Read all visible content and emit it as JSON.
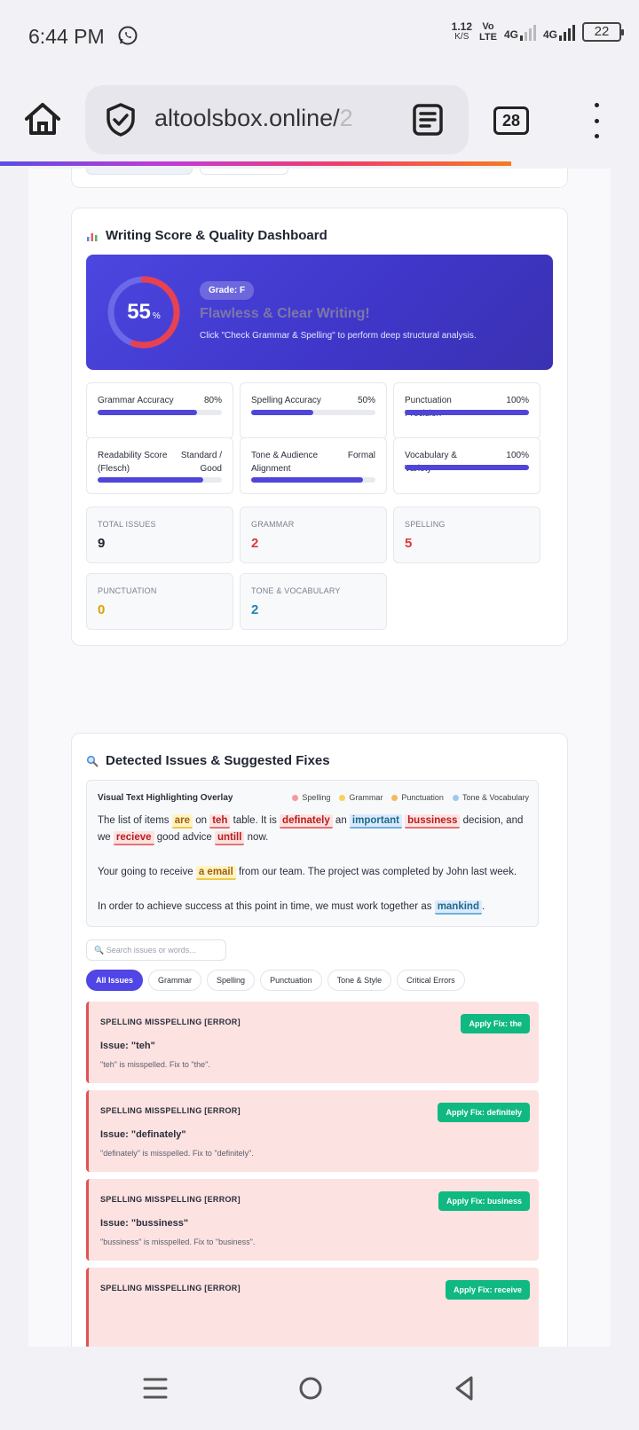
{
  "status": {
    "time": "6:44 PM",
    "net_speed": "1.12",
    "net_unit": "K/S",
    "volte_top": "Vo",
    "volte_bottom": "LTE",
    "sig1": "4G",
    "sig2": "4G",
    "battery": "22"
  },
  "browser": {
    "url": "altoolsbox.online/",
    "url_fade": "2",
    "tab_count": "28"
  },
  "dashboard": {
    "title": "Writing Score & Quality Dashboard",
    "score": 55,
    "score_text": "55",
    "score_unit": "%",
    "grade": "Grade: F",
    "headline": "Flawless & Clear Writing!",
    "subtitle": "Click \"Check Grammar & Spelling\" to perform deep structural analysis.",
    "colors": {
      "ring_progress": "#e8414f",
      "ring_track": "#6d68e8",
      "bar": "#4f46d9"
    },
    "metrics": [
      {
        "label": "Grammar Accuracy",
        "value": "80%",
        "progress": 80
      },
      {
        "label": "Spelling Accuracy",
        "value": "50%",
        "progress": 50
      },
      {
        "label": "Punctuation Precision",
        "value": "100%",
        "progress": 100
      },
      {
        "label": "Readability Score (Flesch)",
        "value": "Standard / Good",
        "progress": 85
      },
      {
        "label": "Tone & Audience Alignment",
        "value": "Formal",
        "progress": 90
      },
      {
        "label": "Vocabulary & Variety",
        "value": "100%",
        "progress": 100
      }
    ],
    "stats": [
      {
        "label": "TOTAL ISSUES",
        "value": "9",
        "color": "#1f2430"
      },
      {
        "label": "GRAMMAR",
        "value": "2",
        "color": "#dc3a3a"
      },
      {
        "label": "SPELLING",
        "value": "5",
        "color": "#dc3a3a"
      },
      {
        "label": "PUNCTUATION",
        "value": "0",
        "color": "#e0a106"
      },
      {
        "label": "TONE & VOCABULARY",
        "value": "2",
        "color": "#1f84b3"
      }
    ]
  },
  "issues_section": {
    "title": "Detected Issues & Suggested Fixes",
    "overlay_title": "Visual Text Highlighting Overlay",
    "legend": [
      {
        "label": "Spelling",
        "color": "#f29b9b"
      },
      {
        "label": "Grammar",
        "color": "#f4d35e"
      },
      {
        "label": "Punctuation",
        "color": "#f6b860"
      },
      {
        "label": "Tone & Vocabulary",
        "color": "#9cc9ef"
      }
    ],
    "text": {
      "p1_a": "The list of items ",
      "p1_are": "are",
      "p1_b": " on ",
      "p1_teh": "teh",
      "p1_c": " table. It is ",
      "p1_definately": "definately",
      "p1_d": " an ",
      "p1_important": "important",
      "p1_e": " ",
      "p1_bussiness": "bussiness",
      "p1_f": " decision, and we ",
      "p1_recieve": "recieve",
      "p1_g": " good advice ",
      "p1_untill": "untill",
      "p1_h": " now.",
      "p2_a": "Your going to receive ",
      "p2_aemail": "a email",
      "p2_b": " from our team. The project was completed by John last week.",
      "p3_a": "In order to achieve success at this point in time, we must work together as ",
      "p3_mankind": "mankind",
      "p3_b": "."
    },
    "search_placeholder": "Search issues or words...",
    "filters": [
      "All Issues",
      "Grammar",
      "Spelling",
      "Punctuation",
      "Tone & Style",
      "Critical Errors"
    ],
    "issues": [
      {
        "header": "SPELLING MISSPELLING [ERROR]",
        "title": "Issue: \"teh\"",
        "desc": "\"teh\" is misspelled. Fix to \"the\".",
        "fix": "Apply Fix: the"
      },
      {
        "header": "SPELLING MISSPELLING [ERROR]",
        "title": "Issue: \"definately\"",
        "desc": "\"definately\" is misspelled. Fix to \"definitely\".",
        "fix": "Apply Fix: definitely"
      },
      {
        "header": "SPELLING MISSPELLING [ERROR]",
        "title": "Issue: \"bussiness\"",
        "desc": "\"bussiness\" is misspelled. Fix to \"business\".",
        "fix": "Apply Fix: business"
      },
      {
        "header": "SPELLING MISSPELLING [ERROR]",
        "title": "",
        "desc": "",
        "fix": "Apply Fix: receive"
      }
    ]
  }
}
